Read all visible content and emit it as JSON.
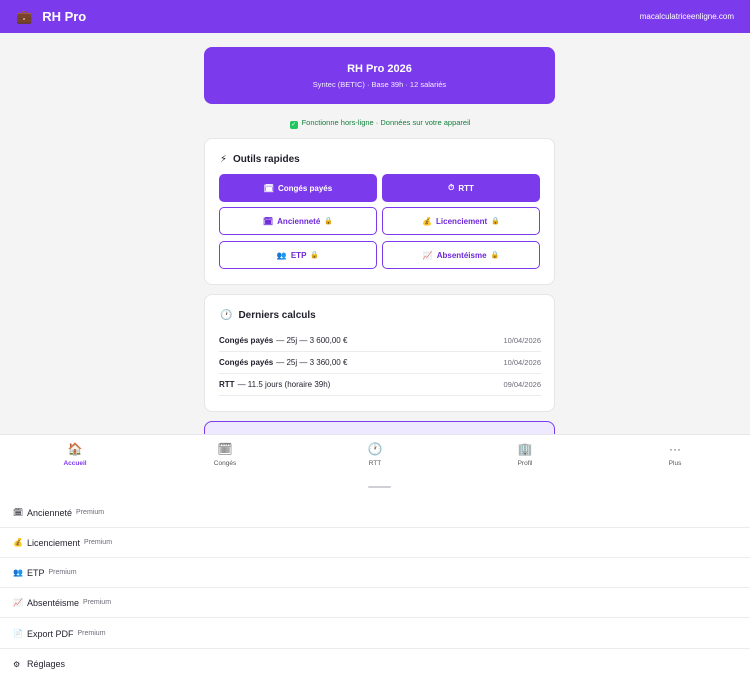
{
  "topbar": {
    "logo_icon": "💼",
    "title": "RH Pro",
    "site": "macalculatriceenligne.com"
  },
  "hero": {
    "title": "RH Pro 2026",
    "subtitle": "Syntec (BETIC) · Base 39h · 12 salariés"
  },
  "offline_notice": {
    "icon": "✓",
    "text": "Fonctionne hors-ligne · Données sur votre appareil"
  },
  "quick_tools": {
    "icon": "⚡",
    "title": "Outils rapides",
    "items": [
      {
        "icon": "🗓",
        "label": "Congés payés",
        "lock": ""
      },
      {
        "icon": "⏱",
        "label": "RTT",
        "lock": ""
      },
      {
        "icon": "🗓",
        "label": "Ancienneté",
        "lock": "🔒"
      },
      {
        "icon": "💰",
        "label": "Licenciement",
        "lock": "🔒"
      },
      {
        "icon": "👥",
        "label": "ETP",
        "lock": "🔒"
      },
      {
        "icon": "📈",
        "label": "Absentéisme",
        "lock": "🔒"
      }
    ]
  },
  "recent": {
    "icon": "🕐",
    "title": "Derniers calculs",
    "items": [
      {
        "strong": "Congés payés",
        "detail": "— 25j — 3 600,00 €",
        "date": "10/04/2026"
      },
      {
        "strong": "Congés payés",
        "detail": "— 25j — 3 360,00 €",
        "date": "10/04/2026"
      },
      {
        "strong": "RTT",
        "detail": "— 11.5 jours (horaire 39h)",
        "date": "09/04/2026"
      }
    ]
  },
  "bottom_nav": [
    {
      "icon": "🏠",
      "label": "Accueil"
    },
    {
      "icon": "🗓",
      "label": "Congés"
    },
    {
      "icon": "🕐",
      "label": "RTT"
    },
    {
      "icon": "🏢",
      "label": "Profil"
    },
    {
      "icon": "···",
      "label": "Plus"
    }
  ],
  "more_menu": [
    {
      "icon": "🗓",
      "label": "Ancienneté",
      "badge": "Premium"
    },
    {
      "icon": "💰",
      "label": "Licenciement",
      "badge": "Premium"
    },
    {
      "icon": "👥",
      "label": "ETP",
      "badge": "Premium"
    },
    {
      "icon": "📈",
      "label": "Absentéisme",
      "badge": "Premium"
    },
    {
      "icon": "📄",
      "label": "Export PDF",
      "badge": "Premium"
    },
    {
      "icon": "⚙",
      "label": "Réglages",
      "badge": ""
    }
  ],
  "colors": {
    "accent": "#7c3aed",
    "success": "#15803d",
    "peek_fill": "#efe9ff"
  }
}
